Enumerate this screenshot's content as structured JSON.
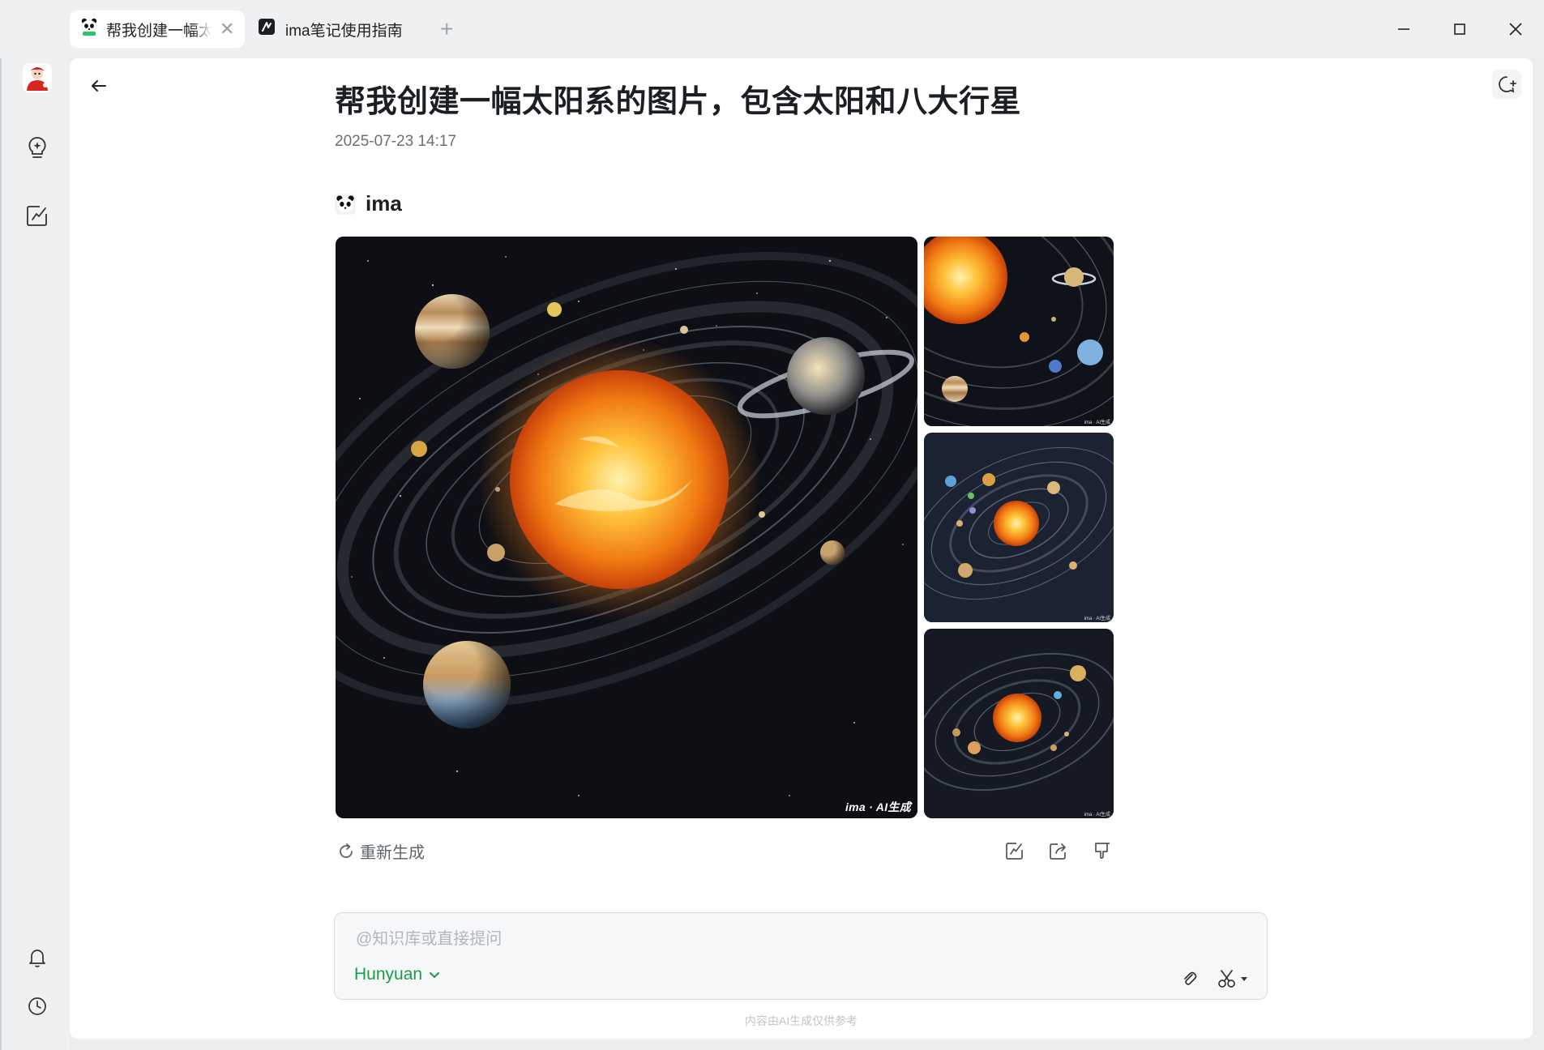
{
  "tabs": [
    {
      "title": "帮我创建一幅太阳系的图片，包含太阳和八大行星",
      "icon": "panda-icon",
      "active": true
    },
    {
      "title": "ima笔记使用指南",
      "icon": "notes-icon",
      "active": false
    }
  ],
  "conversation": {
    "title": "帮我创建一幅太阳系的图片，包含太阳和八大行星",
    "timestamp": "2025-07-23 14:17",
    "author": "ima",
    "watermark": "ima · AI生成",
    "thumb_watermark": "ima · AI生成",
    "regenerate_label": "重新生成"
  },
  "composer": {
    "placeholder": "@知识库或直接提问",
    "model": "Hunyuan"
  },
  "footer": {
    "disclaimer": "内容由AI生成仅供参考"
  },
  "colors": {
    "accent_green": "#1a9c47",
    "sun_core": "#ffd24a",
    "sun_edge": "#e2580c",
    "space": "#0d0f14"
  }
}
